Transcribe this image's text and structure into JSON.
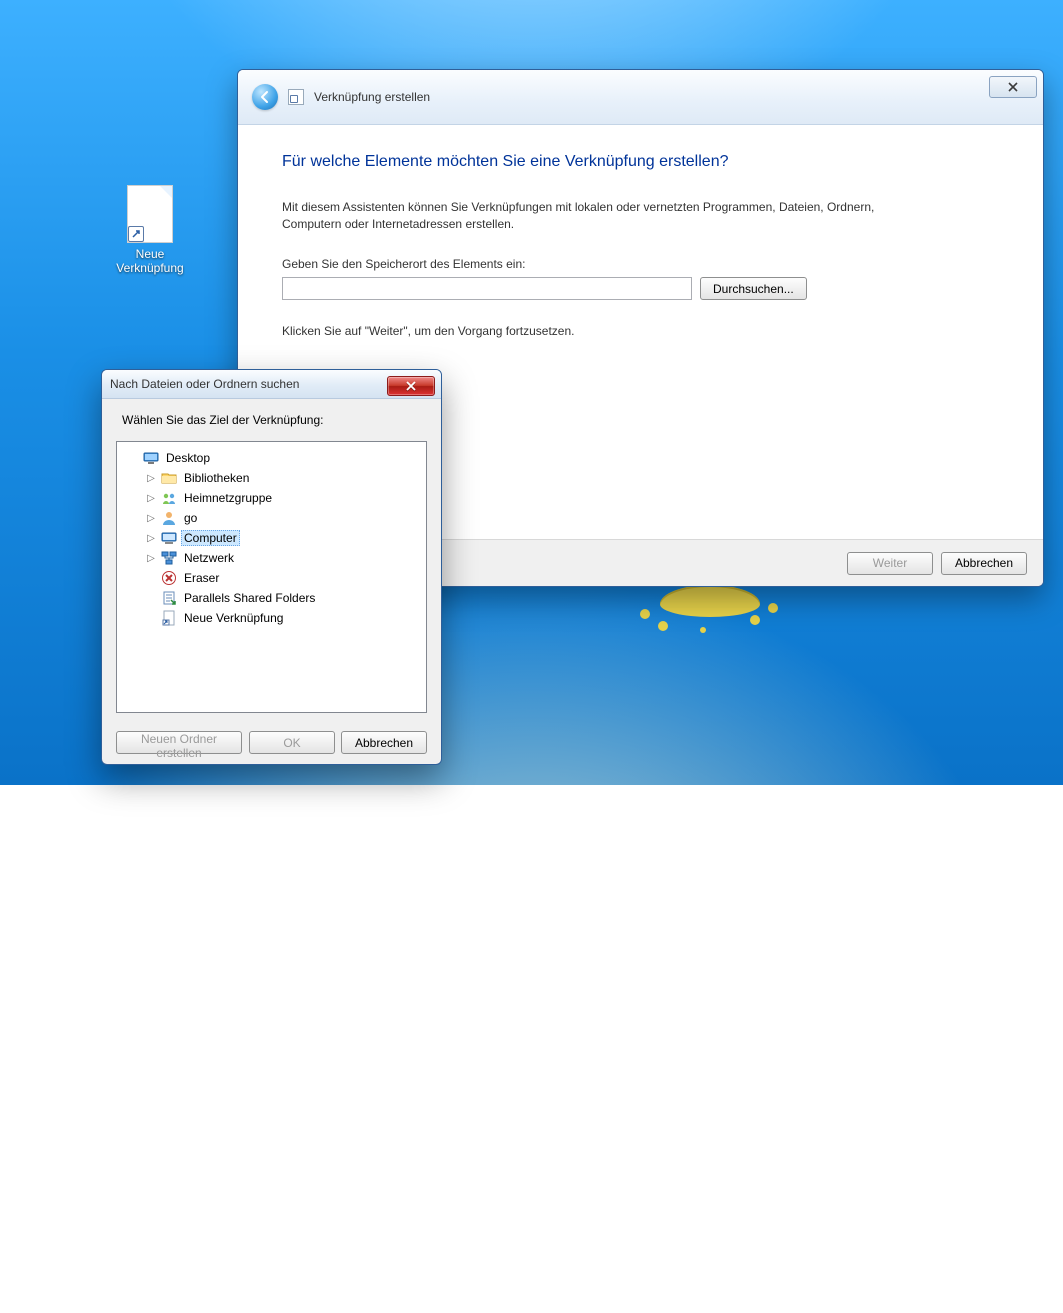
{
  "desktop": {
    "icon_label": "Neue Verknüpfung"
  },
  "wizard": {
    "title": "Verknüpfung erstellen",
    "heading": "Für welche Elemente möchten Sie eine Verknüpfung erstellen?",
    "description": "Mit diesem Assistenten können Sie Verknüpfungen mit lokalen oder vernetzten Programmen, Dateien, Ordnern, Computern oder Internetadressen erstellen.",
    "location_label": "Geben Sie den Speicherort des Elements ein:",
    "location_value": "",
    "browse_label": "Durchsuchen...",
    "hint": "Klicken Sie auf \"Weiter\", um den Vorgang fortzusetzen.",
    "next_label": "Weiter",
    "cancel_label": "Abbrechen"
  },
  "browse": {
    "title": "Nach Dateien oder Ordnern suchen",
    "prompt": "Wählen Sie das Ziel der Verknüpfung:",
    "new_folder_label": "Neuen Ordner erstellen",
    "ok_label": "OK",
    "cancel_label": "Abbrechen",
    "tree": [
      {
        "label": "Desktop",
        "icon": "desktop",
        "indent": 0,
        "expander": "none",
        "selected": false
      },
      {
        "label": "Bibliotheken",
        "icon": "libraries",
        "indent": 1,
        "expander": "closed",
        "selected": false
      },
      {
        "label": "Heimnetzgruppe",
        "icon": "homegroup",
        "indent": 1,
        "expander": "closed",
        "selected": false
      },
      {
        "label": "go",
        "icon": "user",
        "indent": 1,
        "expander": "closed",
        "selected": false
      },
      {
        "label": "Computer",
        "icon": "computer",
        "indent": 1,
        "expander": "closed",
        "selected": true
      },
      {
        "label": "Netzwerk",
        "icon": "network",
        "indent": 1,
        "expander": "closed",
        "selected": false
      },
      {
        "label": "Eraser",
        "icon": "eraser",
        "indent": 1,
        "expander": "none",
        "selected": false
      },
      {
        "label": "Parallels Shared Folders",
        "icon": "shared",
        "indent": 1,
        "expander": "none",
        "selected": false
      },
      {
        "label": "Neue Verknüpfung",
        "icon": "shortcut",
        "indent": 1,
        "expander": "none",
        "selected": false
      }
    ]
  }
}
